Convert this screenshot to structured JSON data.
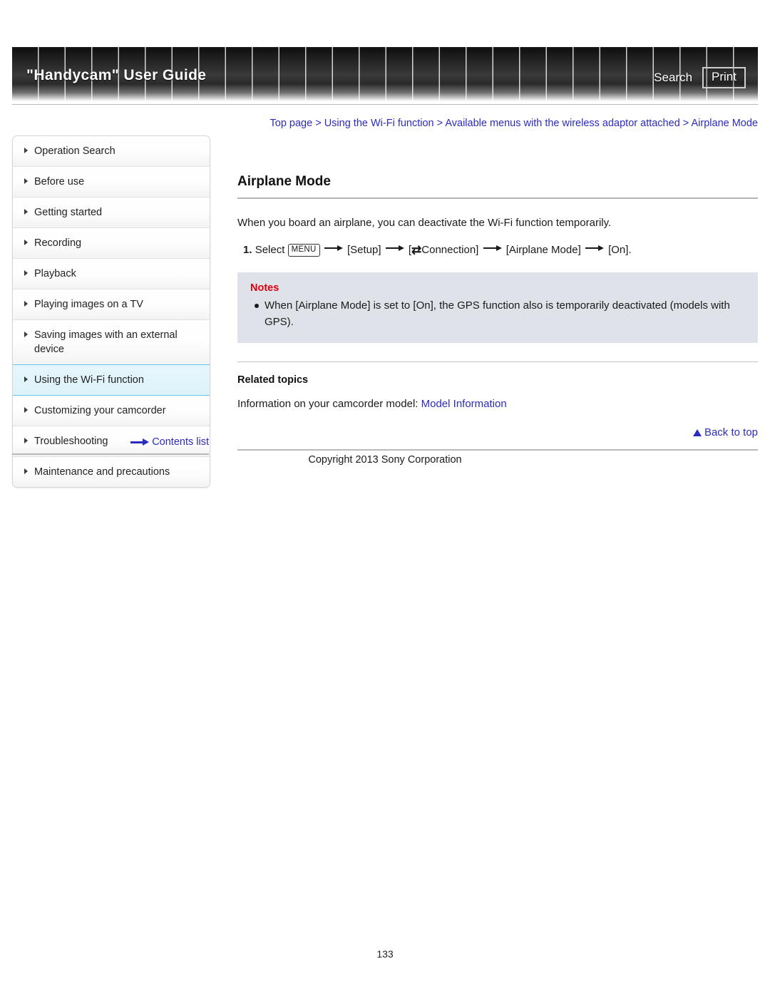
{
  "header": {
    "title": "\"Handycam\" User Guide",
    "search_label": "Search",
    "print_label": "Print"
  },
  "breadcrumb": {
    "items": [
      "Top page",
      "Using the Wi-Fi function",
      "Available menus with the wireless adaptor attached",
      "Airplane Mode"
    ],
    "separator": ">"
  },
  "sidebar": {
    "items": [
      {
        "label": "Operation Search",
        "active": false
      },
      {
        "label": "Before use",
        "active": false
      },
      {
        "label": "Getting started",
        "active": false
      },
      {
        "label": "Recording",
        "active": false
      },
      {
        "label": "Playback",
        "active": false
      },
      {
        "label": "Playing images on a TV",
        "active": false
      },
      {
        "label": "Saving images with an external device",
        "active": false
      },
      {
        "label": "Using the Wi-Fi function",
        "active": true
      },
      {
        "label": "Customizing your camcorder",
        "active": false
      },
      {
        "label": "Troubleshooting",
        "active": false
      },
      {
        "label": "Maintenance and precautions",
        "active": false
      }
    ],
    "contents_link": "Contents list"
  },
  "main": {
    "title": "Airplane Mode",
    "intro": "When you board an airplane, you can deactivate the Wi-Fi function temporarily.",
    "step": {
      "number": "1.",
      "verb": "Select",
      "menu_chip": "MENU",
      "item_setup": "[Setup]",
      "bracket_open": "[",
      "connection_icon": "⇄",
      "item_connection": "Connection]",
      "item_airplane": "[Airplane Mode]",
      "item_on": "[On]."
    },
    "notes": {
      "title": "Notes",
      "items": [
        "When [Airplane Mode] is set to [On], the GPS function also is temporarily deactivated (models with GPS)."
      ]
    },
    "related": {
      "title": "Related topics",
      "line_prefix": "Information on your camcorder model:",
      "link": "Model Information"
    },
    "back_to_top": "Back to top"
  },
  "footer": {
    "copyright": "Copyright 2013 Sony Corporation",
    "page_number": "133"
  },
  "colors": {
    "link": "#2b2bbf",
    "notes_heading": "#d8000c",
    "notes_background": "#dfe3e9",
    "sidebar_active_background": "#ddf2fa",
    "sidebar_active_border": "#67c6e6"
  }
}
